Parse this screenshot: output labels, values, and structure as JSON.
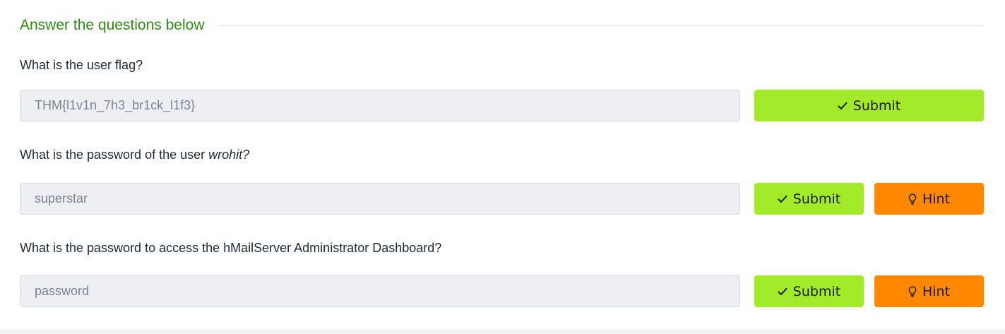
{
  "section": {
    "title": "Answer the questions below"
  },
  "questions": [
    {
      "text": "What is the user flag?",
      "answer": "THM{l1v1n_7h3_br1ck_l1f3}",
      "submit_label": "Submit"
    },
    {
      "text_prefix": "What is the password of the user ",
      "text_emphasis": "wrohit?",
      "answer": "superstar",
      "submit_label": "Submit",
      "hint_label": "Hint"
    },
    {
      "text": "What is the password to access the hMailServer Administrator Dashboard?",
      "answer": "password",
      "submit_label": "Submit",
      "hint_label": "Hint"
    }
  ],
  "icons": {
    "submit": "check-icon",
    "hint": "lightbulb-icon"
  },
  "colors": {
    "title": "#2e8b12",
    "submit_button": "#a3ea2a",
    "hint_button": "#ff8800",
    "answer_field_bg": "#eeeff2"
  }
}
